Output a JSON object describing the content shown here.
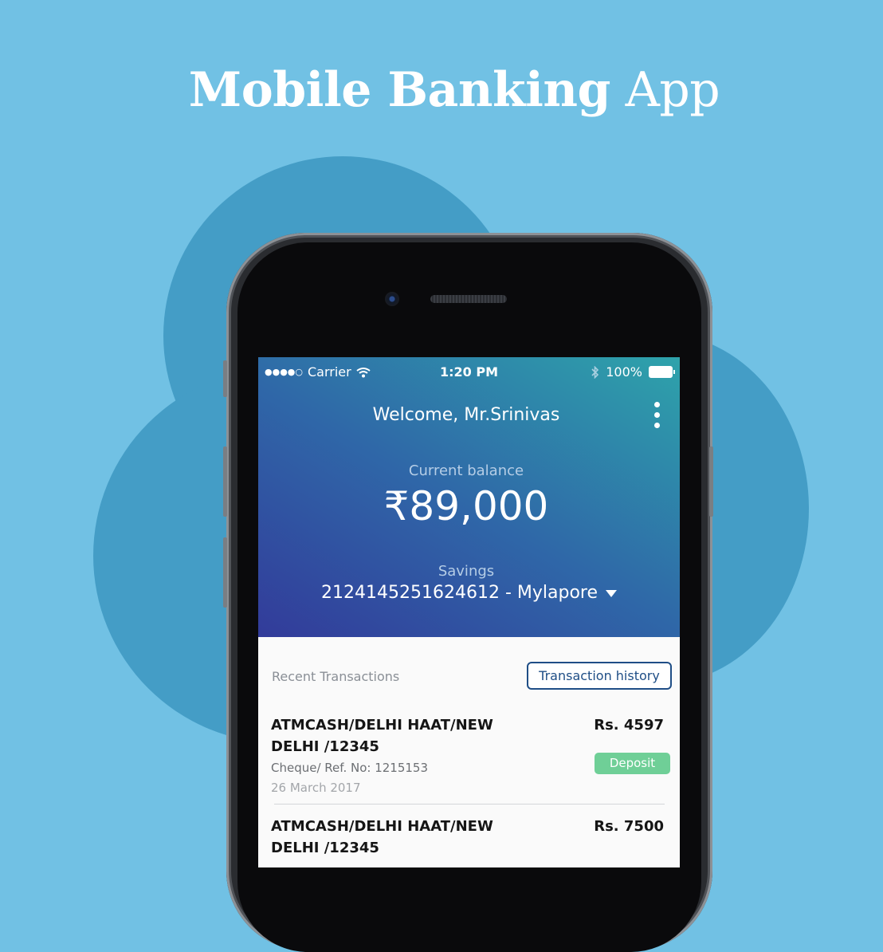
{
  "headline": {
    "bold": "Mobile Banking",
    "regular": "App"
  },
  "status_bar": {
    "signal_dots": "●●●●○",
    "carrier": "Carrier",
    "wifi_icon": "wifi-icon",
    "time": "1:20 PM",
    "bluetooth_icon": "bluetooth-icon",
    "battery_percent": "100%",
    "battery_level": 1.0
  },
  "header": {
    "welcome": "Welcome, Mr.Srinivas",
    "menu_icon": "kebab-menu-icon"
  },
  "balance": {
    "label": "Current balance",
    "value": "₹89,000"
  },
  "account": {
    "type": "Savings",
    "number": "2124145251624612 - Mylapore",
    "dropdown_icon": "caret-down-icon"
  },
  "transactions_section": {
    "title": "Recent Transactions",
    "history_button": "Transaction history"
  },
  "transactions": [
    {
      "title": "ATMCASH/DELHI HAAT/NEW DELHI /12345",
      "amount": "Rs. 4597",
      "reference": "Cheque/ Ref. No: 1215153",
      "date": "26 March 2017",
      "badge": "Deposit"
    },
    {
      "title": "ATMCASH/DELHI HAAT/NEW DELHI /12345",
      "amount": "Rs. 7500"
    }
  ],
  "colors": {
    "background": "#71c1e4",
    "blob": "#449dc6",
    "gradient_start": "#323b9a",
    "gradient_end": "#2ea3ab",
    "accent": "#1f4e86",
    "deposit_badge": "#6fcf97"
  }
}
